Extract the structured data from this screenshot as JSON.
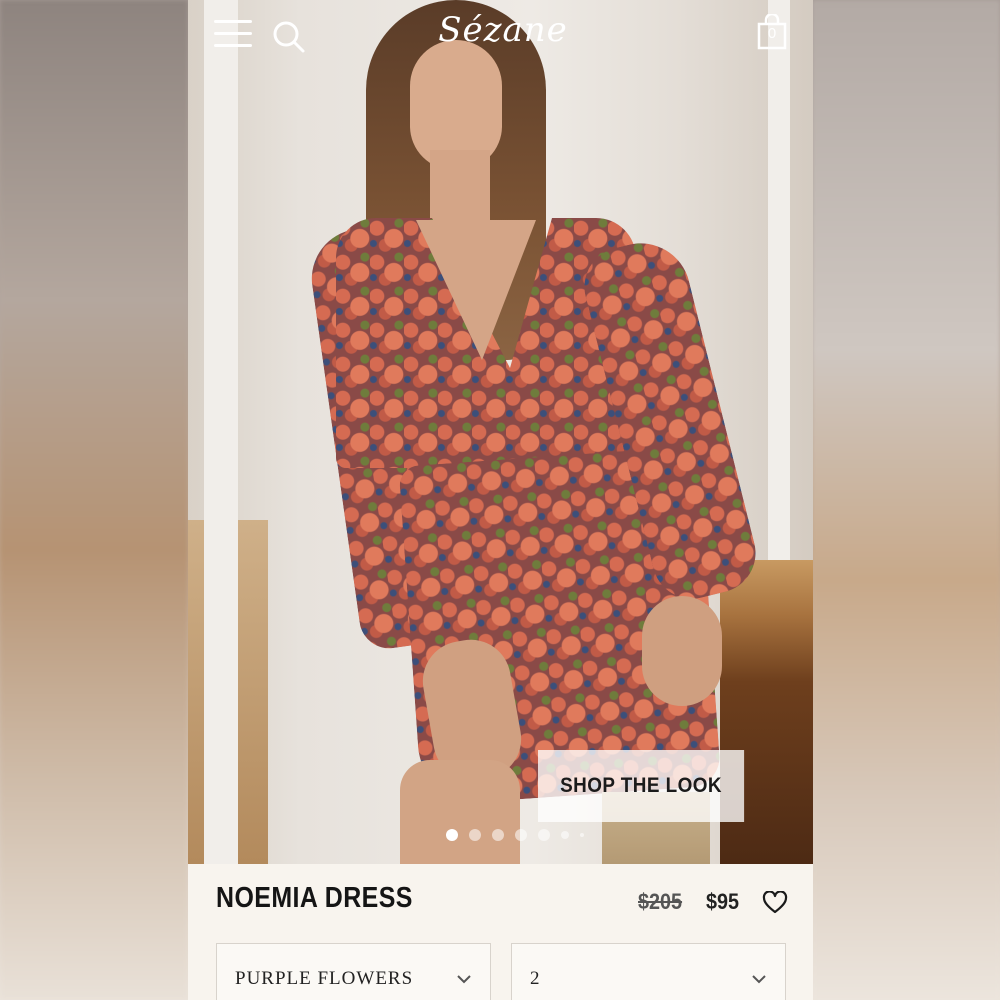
{
  "header": {
    "logo_text": "Sézane",
    "bag_count": "0",
    "menu_icon": "hamburger-menu-icon",
    "search_icon": "search-icon",
    "bag_icon": "shopping-bag-icon"
  },
  "hero": {
    "cta_label": "SHOP THE LOOK",
    "carousel_total_dots": 7,
    "carousel_active_index": 0
  },
  "product": {
    "name": "NOEMIA DRESS",
    "original_price": "$205",
    "sale_price": "$95",
    "wishlist_icon": "heart-icon"
  },
  "options": {
    "color_selected": "PURPLE FLOWERS",
    "size_selected": "2"
  },
  "colors": {
    "background": "#f8f4ee",
    "text": "#151515",
    "dress_primary": "#8a4a47",
    "dress_accent": "#d56b52"
  }
}
